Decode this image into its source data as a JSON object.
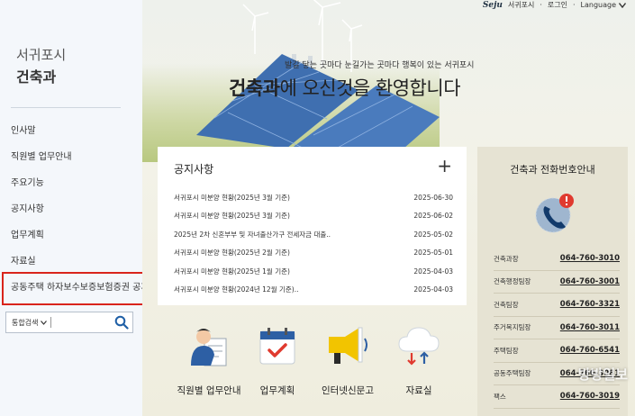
{
  "sidebar": {
    "city": "서귀포시",
    "dept": "건축과",
    "menu": [
      "인사말",
      "직원별 업무안내",
      "주요기능",
      "공지사항",
      "업무계획",
      "자료실",
      "공동주택 하자보수보증보험증권 공개"
    ],
    "search": {
      "scope": "통합검색",
      "placeholder": ""
    }
  },
  "header": {
    "logo_text": "Seju",
    "city_label": "서귀포시",
    "login": "로그인",
    "language": "Language",
    "divider": "·",
    "slogan": "발길 닿는 곳마다 눈길가는 곳마다 행복이 있는 서귀포시",
    "welcome_bold": "건축과",
    "welcome_rest": "에 오신것을 환영합니다"
  },
  "notice": {
    "title": "공지사항",
    "more": "+",
    "items": [
      {
        "title": "서귀포시 미분양 현황(2025년 3월 기준)",
        "date": "2025-06-30"
      },
      {
        "title": "서귀포시 미분양 현황(2025년 3월 기준)",
        "date": "2025-06-02"
      },
      {
        "title": "2025년 2차 신혼부부 및 자녀출산가구 전세자금 대출..",
        "date": "2025-05-02"
      },
      {
        "title": "서귀포시 미분양 현황(2025년 2월 기준)",
        "date": "2025-05-01"
      },
      {
        "title": "서귀포시 미분양 현황(2025년 1월 기준)",
        "date": "2025-04-03"
      },
      {
        "title": "서귀포시 미분양 현황(2024년 12월 기준)..",
        "date": "2025-04-03"
      }
    ]
  },
  "phone": {
    "title": "건축과 전화번호안내",
    "items": [
      {
        "label": "건축과장",
        "number": "064-760-3010"
      },
      {
        "label": "건축행정팀장",
        "number": "064-760-3001"
      },
      {
        "label": "건축팀장",
        "number": "064-760-3321"
      },
      {
        "label": "주거복지팀장",
        "number": "064-760-3011"
      },
      {
        "label": "주택팀장",
        "number": "064-760-6541"
      },
      {
        "label": "공동주택팀장",
        "number": "064-760-3081"
      },
      {
        "label": "팩스",
        "number": "064-760-3019"
      }
    ]
  },
  "quick": [
    "직원별 업무안내",
    "업무계획",
    "인터넷신문고",
    "자료실"
  ],
  "watermark": "방방일보",
  "colors": {
    "highlight": "#d9241b",
    "search_icon": "#1f5fa6",
    "megaphone": "#f2c400",
    "alert": "#e03a2f"
  }
}
